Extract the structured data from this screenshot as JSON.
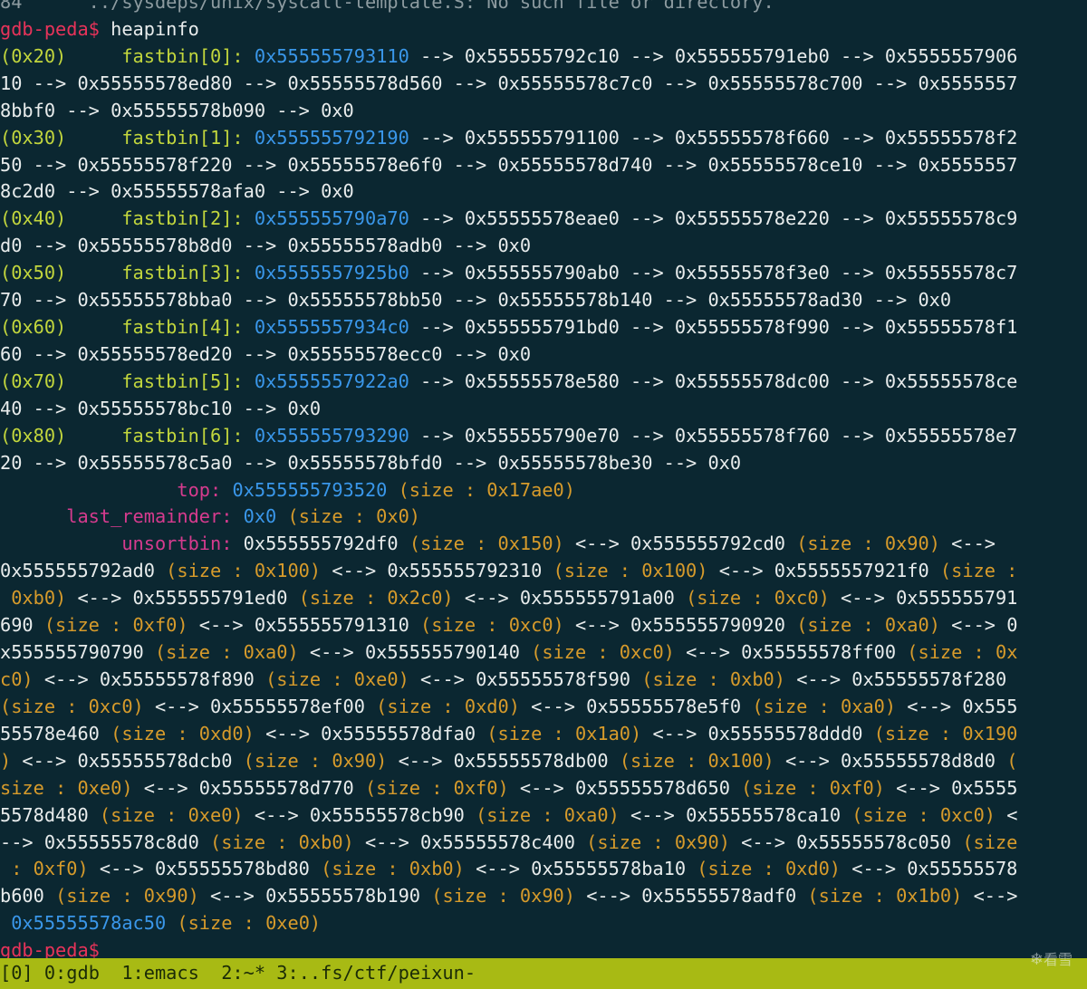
{
  "terminal": {
    "lines": [
      [
        {
          "text": "84      ../sysdeps/unix/syscall-template.S: No such file or directory.",
          "color": "dim"
        }
      ],
      [
        {
          "text": "gdb-peda$",
          "color": "red"
        },
        {
          "text": " heapinfo",
          "color": "default"
        }
      ],
      [
        {
          "text": "(0x20)     ",
          "color": "yellow"
        },
        {
          "text": "fastbin[0]:",
          "color": "yellow"
        },
        {
          "text": " ",
          "color": "default"
        },
        {
          "text": "0x555555793110",
          "color": "blue"
        },
        {
          "text": " --> 0x555555792c10 --> 0x555555791eb0 --> 0x5555557906",
          "color": "default"
        }
      ],
      [
        {
          "text": "10 --> 0x55555578ed80 --> 0x55555578d560 --> 0x55555578c7c0 --> 0x55555578c700 --> 0x5555557",
          "color": "default"
        }
      ],
      [
        {
          "text": "8bbf0 --> 0x55555578b090 --> 0x0",
          "color": "default"
        }
      ],
      [
        {
          "text": "(0x30)     ",
          "color": "yellow"
        },
        {
          "text": "fastbin[1]:",
          "color": "yellow"
        },
        {
          "text": " ",
          "color": "default"
        },
        {
          "text": "0x555555792190",
          "color": "blue"
        },
        {
          "text": " --> 0x555555791100 --> 0x55555578f660 --> 0x55555578f2",
          "color": "default"
        }
      ],
      [
        {
          "text": "50 --> 0x55555578f220 --> 0x55555578e6f0 --> 0x55555578d740 --> 0x55555578ce10 --> 0x5555557",
          "color": "default"
        }
      ],
      [
        {
          "text": "8c2d0 --> 0x55555578afa0 --> 0x0",
          "color": "default"
        }
      ],
      [
        {
          "text": "(0x40)     ",
          "color": "yellow"
        },
        {
          "text": "fastbin[2]:",
          "color": "yellow"
        },
        {
          "text": " ",
          "color": "default"
        },
        {
          "text": "0x555555790a70",
          "color": "blue"
        },
        {
          "text": " --> 0x55555578eae0 --> 0x55555578e220 --> 0x55555578c9",
          "color": "default"
        }
      ],
      [
        {
          "text": "d0 --> 0x55555578b8d0 --> 0x55555578adb0 --> 0x0",
          "color": "default"
        }
      ],
      [
        {
          "text": "(0x50)     ",
          "color": "yellow"
        },
        {
          "text": "fastbin[3]:",
          "color": "yellow"
        },
        {
          "text": " ",
          "color": "default"
        },
        {
          "text": "0x5555557925b0",
          "color": "blue"
        },
        {
          "text": " --> 0x555555790ab0 --> 0x55555578f3e0 --> 0x55555578c7",
          "color": "default"
        }
      ],
      [
        {
          "text": "70 --> 0x55555578bba0 --> 0x55555578bb50 --> 0x55555578b140 --> 0x55555578ad30 --> 0x0",
          "color": "default"
        }
      ],
      [
        {
          "text": "(0x60)     ",
          "color": "yellow"
        },
        {
          "text": "fastbin[4]:",
          "color": "yellow"
        },
        {
          "text": " ",
          "color": "default"
        },
        {
          "text": "0x5555557934c0",
          "color": "blue"
        },
        {
          "text": " --> 0x555555791bd0 --> 0x55555578f990 --> 0x55555578f1",
          "color": "default"
        }
      ],
      [
        {
          "text": "60 --> 0x55555578ed20 --> 0x55555578ecc0 --> 0x0",
          "color": "default"
        }
      ],
      [
        {
          "text": "(0x70)     ",
          "color": "yellow"
        },
        {
          "text": "fastbin[5]:",
          "color": "yellow"
        },
        {
          "text": " ",
          "color": "default"
        },
        {
          "text": "0x5555557922a0",
          "color": "blue"
        },
        {
          "text": " --> 0x55555578e580 --> 0x55555578dc00 --> 0x55555578ce",
          "color": "default"
        }
      ],
      [
        {
          "text": "40 --> 0x55555578bc10 --> 0x0",
          "color": "default"
        }
      ],
      [
        {
          "text": "(0x80)     ",
          "color": "yellow"
        },
        {
          "text": "fastbin[6]:",
          "color": "yellow"
        },
        {
          "text": " ",
          "color": "default"
        },
        {
          "text": "0x555555793290",
          "color": "blue"
        },
        {
          "text": " --> 0x555555790e70 --> 0x55555578f760 --> 0x55555578e7",
          "color": "default"
        }
      ],
      [
        {
          "text": "20 --> 0x55555578c5a0 --> 0x55555578bfd0 --> 0x55555578be30 --> 0x0",
          "color": "default"
        }
      ],
      [
        {
          "text": "                ",
          "color": "default"
        },
        {
          "text": "top:",
          "color": "magenta"
        },
        {
          "text": " ",
          "color": "default"
        },
        {
          "text": "0x555555793520",
          "color": "blue"
        },
        {
          "text": " (size : 0x17ae0)",
          "color": "orange"
        }
      ],
      [
        {
          "text": "      ",
          "color": "default"
        },
        {
          "text": "last_remainder:",
          "color": "magenta"
        },
        {
          "text": " ",
          "color": "default"
        },
        {
          "text": "0x0",
          "color": "blue"
        },
        {
          "text": " (size : 0x0)",
          "color": "orange"
        }
      ],
      [
        {
          "text": "           ",
          "color": "default"
        },
        {
          "text": "unsortbin:",
          "color": "magenta"
        },
        {
          "text": " 0x555555792df0 ",
          "color": "default"
        },
        {
          "text": "(size : 0x150)",
          "color": "orange"
        },
        {
          "text": " <--> 0x555555792cd0 ",
          "color": "default"
        },
        {
          "text": "(size : 0x90)",
          "color": "orange"
        },
        {
          "text": " <-->",
          "color": "default"
        }
      ],
      [
        {
          "text": "0x555555792ad0 ",
          "color": "default"
        },
        {
          "text": "(size : 0x100)",
          "color": "orange"
        },
        {
          "text": " <--> 0x555555792310 ",
          "color": "default"
        },
        {
          "text": "(size : 0x100)",
          "color": "orange"
        },
        {
          "text": " <--> 0x5555557921f0 ",
          "color": "default"
        },
        {
          "text": "(size :",
          "color": "orange"
        }
      ],
      [
        {
          "text": " 0xb0)",
          "color": "orange"
        },
        {
          "text": " <--> 0x555555791ed0 ",
          "color": "default"
        },
        {
          "text": "(size : 0x2c0)",
          "color": "orange"
        },
        {
          "text": " <--> 0x555555791a00 ",
          "color": "default"
        },
        {
          "text": "(size : 0xc0)",
          "color": "orange"
        },
        {
          "text": " <--> 0x555555791",
          "color": "default"
        }
      ],
      [
        {
          "text": "690 ",
          "color": "default"
        },
        {
          "text": "(size : 0xf0)",
          "color": "orange"
        },
        {
          "text": " <--> 0x555555791310 ",
          "color": "default"
        },
        {
          "text": "(size : 0xc0)",
          "color": "orange"
        },
        {
          "text": " <--> 0x555555790920 ",
          "color": "default"
        },
        {
          "text": "(size : 0xa0)",
          "color": "orange"
        },
        {
          "text": " <--> 0",
          "color": "default"
        }
      ],
      [
        {
          "text": "x555555790790 ",
          "color": "default"
        },
        {
          "text": "(size : 0xa0)",
          "color": "orange"
        },
        {
          "text": " <--> 0x555555790140 ",
          "color": "default"
        },
        {
          "text": "(size : 0xc0)",
          "color": "orange"
        },
        {
          "text": " <--> 0x55555578ff00 ",
          "color": "default"
        },
        {
          "text": "(size : 0x",
          "color": "orange"
        }
      ],
      [
        {
          "text": "c0)",
          "color": "orange"
        },
        {
          "text": " <--> 0x55555578f890 ",
          "color": "default"
        },
        {
          "text": "(size : 0xe0)",
          "color": "orange"
        },
        {
          "text": " <--> 0x55555578f590 ",
          "color": "default"
        },
        {
          "text": "(size : 0xb0)",
          "color": "orange"
        },
        {
          "text": " <--> 0x55555578f280",
          "color": "default"
        }
      ],
      [
        {
          "text": "(size : 0xc0)",
          "color": "orange"
        },
        {
          "text": " <--> 0x55555578ef00 ",
          "color": "default"
        },
        {
          "text": "(size : 0xd0)",
          "color": "orange"
        },
        {
          "text": " <--> 0x55555578e5f0 ",
          "color": "default"
        },
        {
          "text": "(size : 0xa0)",
          "color": "orange"
        },
        {
          "text": " <--> 0x555",
          "color": "default"
        }
      ],
      [
        {
          "text": "55578e460 ",
          "color": "default"
        },
        {
          "text": "(size : 0xd0)",
          "color": "orange"
        },
        {
          "text": " <--> 0x55555578dfa0 ",
          "color": "default"
        },
        {
          "text": "(size : 0x1a0)",
          "color": "orange"
        },
        {
          "text": " <--> 0x55555578ddd0 ",
          "color": "default"
        },
        {
          "text": "(size : 0x190",
          "color": "orange"
        }
      ],
      [
        {
          "text": ")",
          "color": "orange"
        },
        {
          "text": " <--> 0x55555578dcb0 ",
          "color": "default"
        },
        {
          "text": "(size : 0x90)",
          "color": "orange"
        },
        {
          "text": " <--> 0x55555578db00 ",
          "color": "default"
        },
        {
          "text": "(size : 0x100)",
          "color": "orange"
        },
        {
          "text": " <--> 0x55555578d8d0 ",
          "color": "default"
        },
        {
          "text": "(",
          "color": "orange"
        }
      ],
      [
        {
          "text": "size : 0xe0)",
          "color": "orange"
        },
        {
          "text": " <--> 0x55555578d770 ",
          "color": "default"
        },
        {
          "text": "(size : 0xf0)",
          "color": "orange"
        },
        {
          "text": " <--> 0x55555578d650 ",
          "color": "default"
        },
        {
          "text": "(size : 0xf0)",
          "color": "orange"
        },
        {
          "text": " <--> 0x5555",
          "color": "default"
        }
      ],
      [
        {
          "text": "5578d480 ",
          "color": "default"
        },
        {
          "text": "(size : 0xe0)",
          "color": "orange"
        },
        {
          "text": " <--> 0x55555578cb90 ",
          "color": "default"
        },
        {
          "text": "(size : 0xa0)",
          "color": "orange"
        },
        {
          "text": " <--> 0x55555578ca10 ",
          "color": "default"
        },
        {
          "text": "(size : 0xc0)",
          "color": "orange"
        },
        {
          "text": " <",
          "color": "default"
        }
      ],
      [
        {
          "text": "--> 0x55555578c8d0 ",
          "color": "default"
        },
        {
          "text": "(size : 0xb0)",
          "color": "orange"
        },
        {
          "text": " <--> 0x55555578c400 ",
          "color": "default"
        },
        {
          "text": "(size : 0x90)",
          "color": "orange"
        },
        {
          "text": " <--> 0x55555578c050 ",
          "color": "default"
        },
        {
          "text": "(size",
          "color": "orange"
        }
      ],
      [
        {
          "text": " : 0xf0)",
          "color": "orange"
        },
        {
          "text": " <--> 0x55555578bd80 ",
          "color": "default"
        },
        {
          "text": "(size : 0xb0)",
          "color": "orange"
        },
        {
          "text": " <--> 0x55555578ba10 ",
          "color": "default"
        },
        {
          "text": "(size : 0xd0)",
          "color": "orange"
        },
        {
          "text": " <--> 0x55555578",
          "color": "default"
        }
      ],
      [
        {
          "text": "b600 ",
          "color": "default"
        },
        {
          "text": "(size : 0x90)",
          "color": "orange"
        },
        {
          "text": " <--> 0x55555578b190 ",
          "color": "default"
        },
        {
          "text": "(size : 0x90)",
          "color": "orange"
        },
        {
          "text": " <--> 0x55555578adf0 ",
          "color": "default"
        },
        {
          "text": "(size : 0x1b0)",
          "color": "orange"
        },
        {
          "text": " <-->",
          "color": "default"
        }
      ],
      [
        {
          "text": " ",
          "color": "default"
        },
        {
          "text": "0x55555578ac50",
          "color": "blue"
        },
        {
          "text": " (size : 0xe0)",
          "color": "orange"
        }
      ],
      [
        {
          "text": "gdb-peda$",
          "color": "red"
        }
      ]
    ]
  },
  "status_bar": {
    "session": "[0]",
    "windows": " 0:gdb  1:emacs  2:~* 3:..fs/ctf/peixun-"
  },
  "watermark": {
    "icon": "snowflake-icon",
    "text": "看雪"
  },
  "colors": {
    "background": "#0b2731",
    "prompt": "#e8335a",
    "label": "#c2d63d",
    "address": "#3a97ea",
    "size": "#d79b2b",
    "bin_name": "#d63b8e",
    "status_bar": "#a8ba14"
  }
}
